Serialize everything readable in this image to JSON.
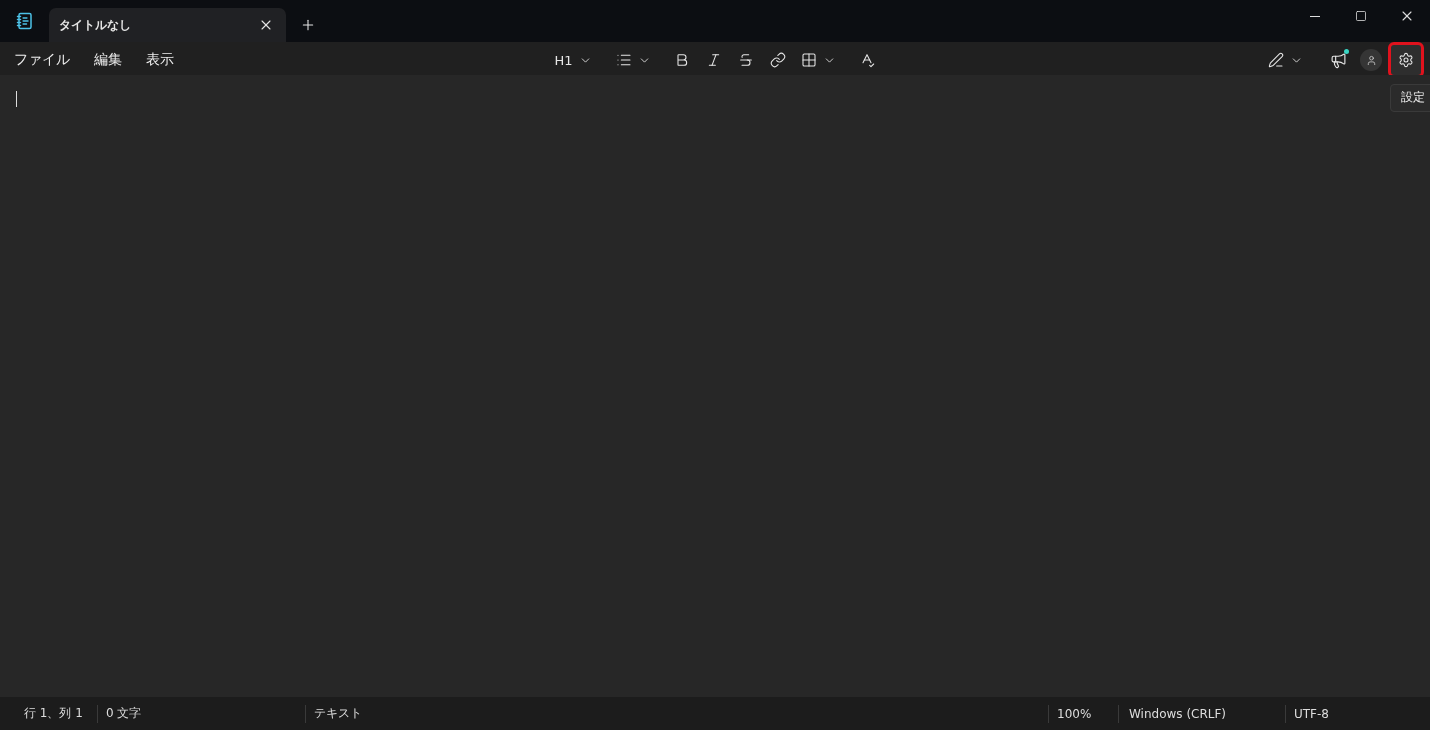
{
  "tabs": [
    {
      "label": "タイトルなし",
      "selected": true
    }
  ],
  "menu": [
    {
      "label": "ファイル"
    },
    {
      "label": "編集"
    },
    {
      "label": "表示"
    }
  ],
  "toolbar": {
    "heading": "H1"
  },
  "right_tools": {
    "whats_new_notification": true,
    "settings_highlighted": true
  },
  "tooltip": "設定",
  "status_bar": [
    {
      "text": "行 1、列 1",
      "kind": "fixed"
    },
    {
      "text": "0 文字",
      "kind": "wide"
    },
    {
      "text": "テキスト",
      "kind": "grow"
    },
    {
      "text": "100%",
      "kind": "fixed"
    },
    {
      "text": "Windows (CRLF)",
      "kind": "wide"
    },
    {
      "text": "UTF-8",
      "kind": "last"
    }
  ]
}
